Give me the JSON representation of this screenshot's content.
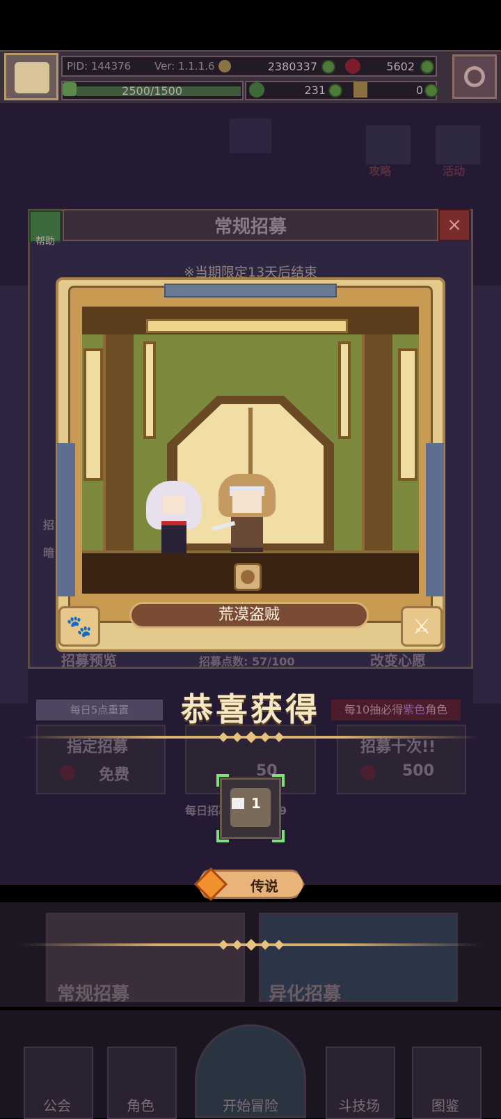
{
  "hud": {
    "pid": "PID: 144376",
    "version": "Ver: 1.1.1.6",
    "gold": "2380337",
    "gems": "5602",
    "stamina": "2500/1500",
    "clover": "231",
    "keys": "0"
  },
  "window": {
    "title": "常规招募",
    "help_label": "帮助",
    "limit_text": "※当期限定13天后结束",
    "close_icon": "×"
  },
  "background_ui": {
    "reset_tag": "每日5点重置",
    "guarantee_prefix": "每10抽必得",
    "guarantee_highlight": "紫色",
    "guarantee_suffix": "角色",
    "preview_btn": "招募预览",
    "points_text": "招募点数: 57/100",
    "wish_btn": "改变心愿",
    "pull_single_label": "指定招募",
    "pull_single_cost": "免费",
    "pull_mid_cost": "50",
    "pull_ten_label": "招募十次!!",
    "pull_ten_cost": "500",
    "daily_limit": "每日招募上限 9999",
    "side_label_1": "招",
    "side_label_2": "暗"
  },
  "reward": {
    "character_name": "荒漠盗贼",
    "congrats": "恭喜获得",
    "item_count": "1",
    "rarity": "传说"
  },
  "banners": [
    {
      "label": "常规招募"
    },
    {
      "label": "异化招募"
    }
  ],
  "nav": [
    {
      "label": "公会"
    },
    {
      "label": "角色"
    },
    {
      "label": "开始冒险"
    },
    {
      "label": "斗技场"
    },
    {
      "label": "图鉴"
    }
  ],
  "top_right_buttons": [
    {
      "label": "攻略"
    },
    {
      "label": "活动"
    }
  ],
  "colors": {
    "accent_gold": "#d8b070",
    "rarity_orange": "#f29030",
    "selection_green": "#7ee27a"
  }
}
